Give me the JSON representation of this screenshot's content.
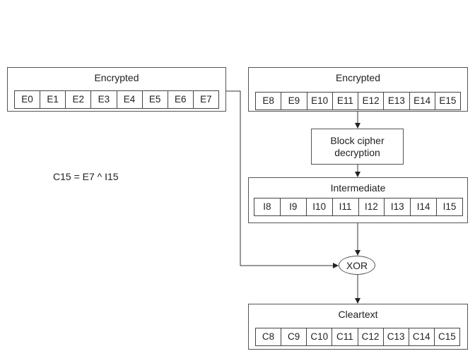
{
  "left_encrypted": {
    "title": "Encrypted",
    "cells": [
      "E0",
      "E1",
      "E2",
      "E3",
      "E4",
      "E5",
      "E6",
      "E7"
    ]
  },
  "right_encrypted": {
    "title": "Encrypted",
    "cells": [
      "E8",
      "E9",
      "E10",
      "E11",
      "E12",
      "E13",
      "E14",
      "E15"
    ]
  },
  "block_cipher": {
    "line1": "Block cipher",
    "line2": "decryption"
  },
  "intermediate": {
    "title": "Intermediate",
    "cells": [
      "I8",
      "I9",
      "I10",
      "I11",
      "I12",
      "I13",
      "I14",
      "I15"
    ]
  },
  "xor": {
    "label": "XOR"
  },
  "cleartext": {
    "title": "Cleartext",
    "cells": [
      "C8",
      "C9",
      "C10",
      "C11",
      "C12",
      "C13",
      "C14",
      "C15"
    ]
  },
  "formula": "C15 = E7 ^ I15"
}
